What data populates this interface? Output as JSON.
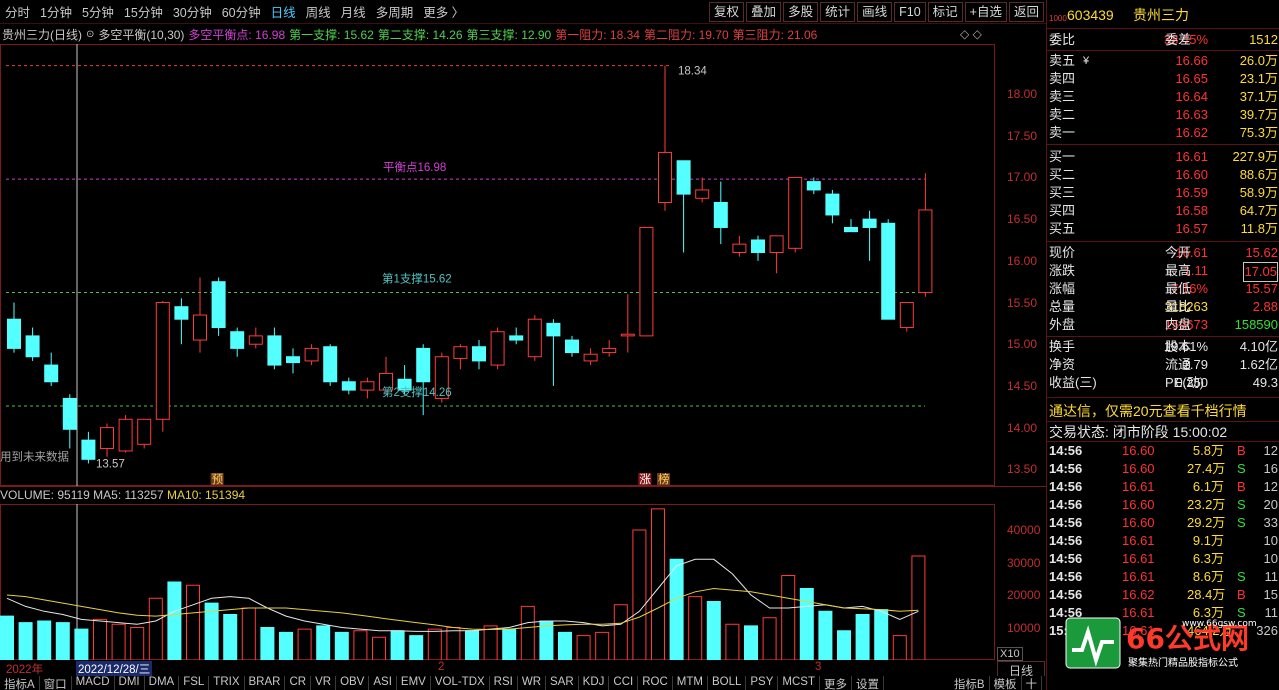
{
  "toolbar": {
    "periods": [
      "分时",
      "1分钟",
      "5分钟",
      "15分钟",
      "30分钟",
      "60分钟",
      "日线",
      "周线",
      "月线",
      "多周期",
      "更多 〉"
    ],
    "active_period": "日线",
    "actions": [
      "复权",
      "叠加",
      "多股",
      "统计",
      "画线",
      "F10",
      "标记",
      "+自选",
      "返回"
    ]
  },
  "indicator": {
    "title": "贵州三力(日线)",
    "name": "多空平衡(10,30)",
    "balance": "多空平衡点: 16.98",
    "s1": "第一支撑: 15.62",
    "s2": "第二支撑: 14.26",
    "s3": "第三支撑: 12.90",
    "r1": "第一阻力: 18.34",
    "r2": "第二阻力: 19.70",
    "r3": "第三阻力: 21.06",
    "balance_label": "平衡点16.98",
    "support1_label": "第1支撑15.62",
    "support2_label": "第2支撑14.26",
    "high_marker": "18.34",
    "low_marker": "13.57",
    "future_note": "用到未来数据",
    "mark_yu": "预",
    "mark_zhang": "涨",
    "mark_bang": "榜"
  },
  "volume_header": {
    "vol": "VOLUME: 95119",
    "ma5": "MA5: 113257",
    "ma10": "MA10: 151394"
  },
  "price_axis": [
    "18.00",
    "17.50",
    "17.00",
    "16.50",
    "16.00",
    "15.50",
    "15.00",
    "14.50",
    "14.00",
    "13.50"
  ],
  "vol_axis": [
    "40000",
    "30000",
    "20000",
    "10000"
  ],
  "vol_unit": "X10",
  "date_axis": {
    "year": "2022年",
    "cursor_date": "2022/12/28/三",
    "m2": "2",
    "m3": "3"
  },
  "period_badge": "日线",
  "bottom_tabs": [
    "指标A",
    "窗口",
    "MACD",
    "DMI",
    "DMA",
    "FSL",
    "TRIX",
    "BRAR",
    "CR",
    "VR",
    "OBV",
    "ASI",
    "EMV",
    "VOL-TDX",
    "RSI",
    "WR",
    "SAR",
    "KDJ",
    "CCI",
    "ROC",
    "MTM",
    "BOLL",
    "PSY",
    "MCST",
    "更多",
    "设置"
  ],
  "bottom_right": [
    "指标B",
    "模板",
    "十"
  ],
  "stock": {
    "code": "603439",
    "name": "贵州三力"
  },
  "ratio": {
    "label1": "委比",
    "v1": "38.45%",
    "label2": "委差",
    "v2": "1512"
  },
  "asks": [
    {
      "label": "卖五",
      "flag": "¥",
      "price": "16.66",
      "vol": "26.0万"
    },
    {
      "label": "卖四",
      "flag": "",
      "price": "16.65",
      "vol": "23.1万"
    },
    {
      "label": "卖三",
      "flag": "",
      "price": "16.64",
      "vol": "37.1万"
    },
    {
      "label": "卖二",
      "flag": "",
      "price": "16.63",
      "vol": "39.7万"
    },
    {
      "label": "卖一",
      "flag": "",
      "price": "16.62",
      "vol": "75.3万"
    }
  ],
  "bids": [
    {
      "label": "买一",
      "price": "16.61",
      "vol": "227.9万"
    },
    {
      "label": "买二",
      "price": "16.60",
      "vol": "88.6万"
    },
    {
      "label": "买三",
      "price": "16.59",
      "vol": "58.9万"
    },
    {
      "label": "买四",
      "price": "16.58",
      "vol": "64.7万"
    },
    {
      "label": "买五",
      "price": "16.57",
      "vol": "11.8万"
    }
  ],
  "quote": [
    {
      "l1": "现价",
      "v1": "16.61",
      "l2": "今开",
      "v2": "15.62"
    },
    {
      "l1": "涨跌",
      "v1": "1.11",
      "l2": "最高",
      "v2": "17.05"
    },
    {
      "l1": "涨幅",
      "v1": "7.16%",
      "l2": "最低",
      "v2": "15.57"
    },
    {
      "l1": "总量",
      "v1": "318263",
      "l2": "量比",
      "v2": "2.88"
    },
    {
      "l1": "外盘",
      "v1": "159673",
      "l2": "内盘",
      "v2": "158590"
    },
    {
      "l1": "换手",
      "v1": "19.61%",
      "l2": "股本",
      "v2": "4.10亿"
    },
    {
      "l1": "净资",
      "v1": "2.79",
      "l2": "流通",
      "v2": "1.62亿"
    },
    {
      "l1": "收益(三)",
      "v1": "0.250",
      "l2": "PE(动)",
      "v2": "49.3"
    }
  ],
  "promo": "通达信，仅需20元查看千档行情",
  "trade_status": "交易状态: 闭市阶段 15:00:02",
  "ticks": [
    {
      "t": "14:56",
      "p": "16.60",
      "v": "5.8万",
      "s": "B",
      "n": "12"
    },
    {
      "t": "14:56",
      "p": "16.60",
      "v": "27.4万",
      "s": "S",
      "n": "16"
    },
    {
      "t": "14:56",
      "p": "16.61",
      "v": "6.1万",
      "s": "B",
      "n": "12"
    },
    {
      "t": "14:56",
      "p": "16.60",
      "v": "23.2万",
      "s": "S",
      "n": "20"
    },
    {
      "t": "14:56",
      "p": "16.60",
      "v": "29.2万",
      "s": "S",
      "n": "33"
    },
    {
      "t": "14:56",
      "p": "16.61",
      "v": "9.1万",
      "s": "",
      "n": "10"
    },
    {
      "t": "14:56",
      "p": "16.61",
      "v": "6.3万",
      "s": "",
      "n": "10"
    },
    {
      "t": "14:56",
      "p": "16.61",
      "v": "8.6万",
      "s": "S",
      "n": "11"
    },
    {
      "t": "14:56",
      "p": "16.62",
      "v": "28.4万",
      "s": "B",
      "n": "15"
    },
    {
      "t": "14:56",
      "p": "16.61",
      "v": "6.3万",
      "s": "S",
      "n": "11"
    },
    {
      "t": "15:00",
      "p": "16.61",
      "v": "464.2万",
      "s": "",
      "n": "326"
    }
  ],
  "logo": {
    "brand": "66公式网",
    "sub": "聚集热门精品股指标公式",
    "url": "www.66gsw.com"
  },
  "chart_data": {
    "type": "candlestick",
    "ylim": [
      13.3,
      18.6
    ],
    "vol_ylim": [
      0,
      48000
    ],
    "reference_lines": [
      16.98,
      15.62,
      14.26,
      18.34
    ],
    "candles": [
      {
        "o": 15.3,
        "h": 15.5,
        "l": 14.9,
        "c": 14.95
      },
      {
        "o": 15.1,
        "h": 15.2,
        "l": 14.8,
        "c": 14.85
      },
      {
        "o": 14.75,
        "h": 14.9,
        "l": 14.5,
        "c": 14.55
      },
      {
        "o": 14.35,
        "h": 14.4,
        "l": 13.75,
        "c": 13.98
      },
      {
        "o": 13.85,
        "h": 13.95,
        "l": 13.57,
        "c": 13.62
      },
      {
        "o": 13.75,
        "h": 14.05,
        "l": 13.65,
        "c": 14.0
      },
      {
        "o": 13.72,
        "h": 14.15,
        "l": 13.7,
        "c": 14.1
      },
      {
        "o": 13.8,
        "h": 14.1,
        "l": 13.75,
        "c": 14.1
      },
      {
        "o": 14.1,
        "h": 15.52,
        "l": 13.95,
        "c": 15.5
      },
      {
        "o": 15.45,
        "h": 15.55,
        "l": 15.0,
        "c": 15.3
      },
      {
        "o": 15.05,
        "h": 15.8,
        "l": 14.9,
        "c": 15.35
      },
      {
        "o": 15.75,
        "h": 15.8,
        "l": 15.1,
        "c": 15.2
      },
      {
        "o": 15.15,
        "h": 15.2,
        "l": 14.85,
        "c": 14.95
      },
      {
        "o": 15.0,
        "h": 15.2,
        "l": 14.95,
        "c": 15.1
      },
      {
        "o": 15.1,
        "h": 15.2,
        "l": 14.7,
        "c": 14.75
      },
      {
        "o": 14.85,
        "h": 14.95,
        "l": 14.65,
        "c": 14.78
      },
      {
        "o": 14.8,
        "h": 15.0,
        "l": 14.75,
        "c": 14.95
      },
      {
        "o": 14.97,
        "h": 15.0,
        "l": 14.5,
        "c": 14.55
      },
      {
        "o": 14.55,
        "h": 14.6,
        "l": 14.4,
        "c": 14.45
      },
      {
        "o": 14.45,
        "h": 14.6,
        "l": 14.35,
        "c": 14.55
      },
      {
        "o": 14.45,
        "h": 14.85,
        "l": 14.4,
        "c": 14.65
      },
      {
        "o": 14.58,
        "h": 14.75,
        "l": 14.4,
        "c": 14.45
      },
      {
        "o": 14.95,
        "h": 15.0,
        "l": 14.15,
        "c": 14.55
      },
      {
        "o": 14.35,
        "h": 14.9,
        "l": 14.3,
        "c": 14.85
      },
      {
        "o": 14.83,
        "h": 15.0,
        "l": 14.7,
        "c": 14.97
      },
      {
        "o": 14.97,
        "h": 15.05,
        "l": 14.7,
        "c": 14.8
      },
      {
        "o": 14.75,
        "h": 15.2,
        "l": 14.7,
        "c": 15.15
      },
      {
        "o": 15.1,
        "h": 15.2,
        "l": 15.0,
        "c": 15.05
      },
      {
        "o": 14.85,
        "h": 15.35,
        "l": 14.8,
        "c": 15.3
      },
      {
        "o": 15.25,
        "h": 15.3,
        "l": 14.5,
        "c": 15.1
      },
      {
        "o": 15.05,
        "h": 15.1,
        "l": 14.85,
        "c": 14.9
      },
      {
        "o": 14.8,
        "h": 14.95,
        "l": 14.75,
        "c": 14.88
      },
      {
        "o": 14.9,
        "h": 15.05,
        "l": 14.85,
        "c": 14.95
      },
      {
        "o": 15.1,
        "h": 15.6,
        "l": 14.9,
        "c": 15.12
      },
      {
        "o": 15.1,
        "h": 16.4,
        "l": 15.1,
        "c": 16.4
      },
      {
        "o": 16.7,
        "h": 18.34,
        "l": 16.6,
        "c": 17.3
      },
      {
        "o": 17.2,
        "h": 17.2,
        "l": 16.1,
        "c": 16.8
      },
      {
        "o": 16.75,
        "h": 17.0,
        "l": 16.7,
        "c": 16.85
      },
      {
        "o": 16.7,
        "h": 16.95,
        "l": 16.2,
        "c": 16.4
      },
      {
        "o": 16.1,
        "h": 16.3,
        "l": 16.05,
        "c": 16.2
      },
      {
        "o": 16.25,
        "h": 16.3,
        "l": 16.0,
        "c": 16.1
      },
      {
        "o": 16.1,
        "h": 16.3,
        "l": 15.85,
        "c": 16.3
      },
      {
        "o": 16.15,
        "h": 17.0,
        "l": 16.1,
        "c": 17.0
      },
      {
        "o": 16.95,
        "h": 17.0,
        "l": 16.8,
        "c": 16.85
      },
      {
        "o": 16.8,
        "h": 16.85,
        "l": 16.45,
        "c": 16.55
      },
      {
        "o": 16.4,
        "h": 16.5,
        "l": 16.35,
        "c": 16.35
      },
      {
        "o": 16.5,
        "h": 16.6,
        "l": 16.0,
        "c": 16.4
      },
      {
        "o": 16.45,
        "h": 16.5,
        "l": 15.3,
        "c": 15.3
      },
      {
        "o": 15.2,
        "h": 15.5,
        "l": 15.15,
        "c": 15.5
      },
      {
        "o": 15.62,
        "h": 17.05,
        "l": 15.57,
        "c": 16.61
      }
    ],
    "volume": [
      13500,
      11500,
      12000,
      11500,
      9500,
      12500,
      11000,
      10000,
      19000,
      24000,
      23000,
      17500,
      14000,
      16000,
      10000,
      8500,
      9500,
      10500,
      8500,
      9000,
      7000,
      9000,
      7500,
      9500,
      10000,
      9000,
      10500,
      9500,
      16500,
      12000,
      8500,
      7500,
      8500,
      17000,
      40000,
      46500,
      31000,
      19500,
      18000,
      11000,
      10500,
      13000,
      26000,
      22000,
      15000,
      9000,
      14000,
      15500,
      7500,
      32000
    ],
    "ma5": [
      19000,
      16500,
      15000,
      14000,
      12500,
      12000,
      11500,
      11000,
      12000,
      15000,
      17000,
      19000,
      19500,
      19000,
      16000,
      13500,
      12000,
      11000,
      10000,
      9500,
      9000,
      9000,
      8800,
      8800,
      9000,
      9000,
      9500,
      10000,
      11500,
      12000,
      12000,
      11500,
      10500,
      11000,
      15000,
      22000,
      29000,
      31000,
      31000,
      26500,
      20000,
      16000,
      16000,
      16500,
      17000,
      16000,
      16500,
      15000,
      12500,
      15000
    ],
    "ma10": [
      20000,
      19500,
      18500,
      17500,
      16500,
      15500,
      14500,
      13800,
      13500,
      14000,
      14500,
      15000,
      15500,
      16000,
      16000,
      16000,
      15500,
      15000,
      14500,
      13800,
      13000,
      12200,
      11500,
      10800,
      10000,
      9500,
      9400,
      9500,
      10000,
      10500,
      10800,
      11000,
      11000,
      11300,
      13200,
      16000,
      19000,
      21000,
      22000,
      21500,
      21000,
      20000,
      19000,
      18000,
      17000,
      16000,
      15800,
      15500,
      15000,
      15300
    ]
  }
}
